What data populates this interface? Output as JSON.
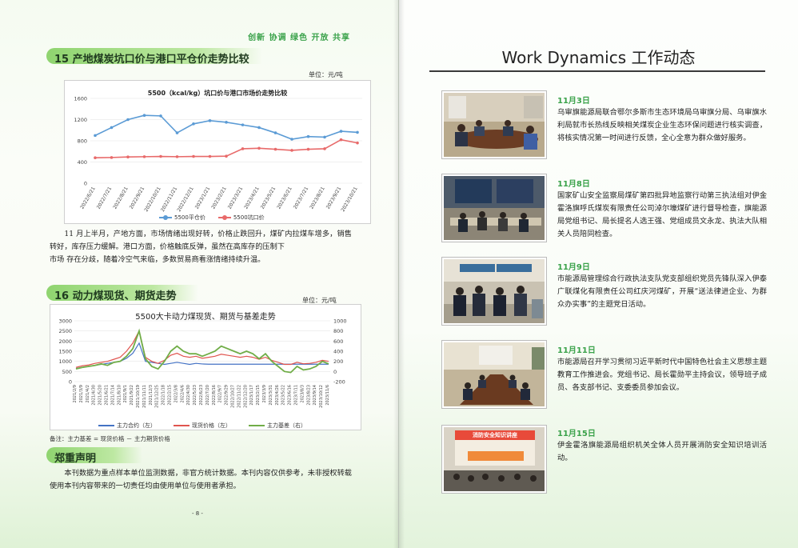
{
  "left": {
    "slogan": "创新 协调 绿色 开放 共享",
    "section15": {
      "heading": "15 产地煤炭坑口价与港口平仓价走势比较",
      "unit": "单位：元/吨",
      "paragraph_a": "11 月上半月，产地方面，市场情绪出现好转，价格止跌回升，煤矿内拉煤车增多，销售转好，库存压力缓解。港口方面，价格触底反弹，虽然在高库存的压制下",
      "paragraph_b": "市场 存在分歧，随着冷空气来临，多数贸易商看涨情绪持续升温。"
    },
    "section16": {
      "heading": "16 动力煤现货、期货走势图",
      "unit": "单位：元/吨",
      "note": "备注：主力基差 = 现货价格 － 主力期货价格"
    },
    "disclaimer": {
      "heading": "郑重声明",
      "text": "本刊数据为重点样本单位监测数据，非官方统计数据。本刊内容仅供参考，未非授权转载使用本刊内容带来的一切责任均由使用单位与使用者承担。"
    },
    "page_number": "- 8 -"
  },
  "chart_data": [
    {
      "type": "line",
      "title": "5500（kcal/kg）坑口价与港口市场价走势比较",
      "ylim": [
        0,
        1600
      ],
      "yticks": [
        "0",
        "400",
        "800",
        "1200",
        "1600"
      ],
      "categories": [
        "2022/6/21",
        "2022/7/21",
        "2022/8/21",
        "2022/9/21",
        "2022/10/21",
        "2022/11/21",
        "2022/12/21",
        "2023/1/21",
        "2023/2/21",
        "2023/3/21",
        "2023/4/21",
        "2023/5/21",
        "2023/6/21",
        "2023/7/21",
        "2023/8/21",
        "2023/9/21",
        "2023/10/21"
      ],
      "series": [
        {
          "name": "5500平仓价",
          "color": "#5b9bd5",
          "values": [
            900,
            1050,
            1200,
            1280,
            1270,
            950,
            1120,
            1180,
            1150,
            1100,
            1050,
            950,
            830,
            880,
            870,
            980,
            960
          ]
        },
        {
          "name": "5500坑口价",
          "color": "#e86a6a",
          "values": [
            480,
            485,
            495,
            500,
            505,
            500,
            505,
            505,
            510,
            650,
            660,
            640,
            620,
            640,
            650,
            820,
            760
          ]
        }
      ]
    },
    {
      "type": "line",
      "title": "5500大卡动力煤现货、期货与基差走势",
      "ylim": [
        0,
        3000
      ],
      "y2lim": [
        -200,
        1000
      ],
      "yticks": [
        "0",
        "500",
        "1000",
        "1500",
        "2000",
        "2500",
        "3000"
      ],
      "y2ticks": [
        "-200",
        "0",
        "200",
        "400",
        "600",
        "800",
        "1000"
      ],
      "categories": [
        "2021/2/9",
        "2021/3/9",
        "2021/4/2",
        "2021/4/30",
        "2021/5/20",
        "2021/6/21",
        "2021/7/14",
        "2021/8/10",
        "2021/9/1",
        "2021/9/22",
        "2021/10/19",
        "2021/11/11",
        "2021/12/3",
        "2021/12/25",
        "2022/1/18",
        "2022/2/15",
        "2022/3/8",
        "2022/4/6",
        "2022/4/30",
        "2022/5/23",
        "2022/6/23",
        "2022/7/20",
        "2022/8/16",
        "2022/9/7",
        "2022/9/29",
        "2022/10/27",
        "2022/11/22",
        "2022/12/20",
        "2023/1/17",
        "2023/2/15",
        "2023/3/9",
        "2023/3/31",
        "2023/4/26",
        "2023/5/22",
        "2023/6/16",
        "2023/7/11",
        "2023/8/3",
        "2023/8/23",
        "2023/9/14",
        "2023/10/12",
        "2023/11/6"
      ],
      "series": [
        {
          "name": "主力合约（左）",
          "color": "#4472c4",
          "values": [
            650,
            700,
            750,
            800,
            850,
            900,
            950,
            1000,
            1150,
            1400,
            1900,
            1000,
            950,
            900,
            850,
            900,
            950,
            900,
            850,
            900,
            870,
            860,
            860,
            860,
            860,
            860,
            860,
            860,
            860,
            860,
            860,
            860,
            860,
            860,
            860,
            860,
            860,
            860,
            860,
            860,
            860
          ]
        },
        {
          "name": "现货价格（左）",
          "color": "#e0544f",
          "values": [
            700,
            780,
            820,
            900,
            950,
            1000,
            1100,
            1200,
            1500,
            1900,
            2500,
            1200,
            1000,
            900,
            1050,
            1300,
            1400,
            1250,
            1200,
            1250,
            1150,
            1200,
            1250,
            1350,
            1300,
            1250,
            1200,
            1250,
            1200,
            1100,
            1200,
            1050,
            950,
            850,
            850,
            950,
            880,
            900,
            950,
            1050,
            1000
          ]
        },
        {
          "name": "主力基差（右）",
          "color": "#70ad47",
          "values": [
            50,
            80,
            100,
            120,
            150,
            120,
            180,
            200,
            300,
            450,
            800,
            250,
            100,
            50,
            200,
            400,
            500,
            400,
            350,
            350,
            300,
            350,
            400,
            500,
            450,
            400,
            350,
            400,
            350,
            250,
            350,
            200,
            100,
            0,
            -20,
            100,
            30,
            50,
            100,
            200,
            150
          ]
        }
      ]
    }
  ],
  "right": {
    "title": "Work Dynamics  工作动态",
    "items": [
      {
        "date": "11月3日",
        "text": "乌审旗能源局联合鄂尔多斯市生态环境局乌审旗分局、乌审旗水利局就市长热线反映相关煤炭企业生态环保问题进行核实调查，将核实情况第一时间进行反馈，全心全意为群众做好服务。"
      },
      {
        "date": "11月8日",
        "text": "国家矿山安全监察局煤矿第四批异地监察行动第三执法组对伊金霍洛旗呼氏煤炭有限责任公司淖尔壕煤矿进行督导检查，旗能源局党组书记、局长提名人选王强、党组成员文永龙、执法大队相关人员陪同检查。"
      },
      {
        "date": "11月9日",
        "text": "市能源局管理综合行政执法支队党支部组织党员先锋队深入伊泰广联煤化有限责任公司红庆河煤矿，开展“送法律进企业、为群众办实事”的主题党日活动。"
      },
      {
        "date": "11月11日",
        "text": "市能源局召开学习贯彻习近平新时代中国特色社会主义思想主题教育工作推进会。党组书记、局长霍勋平主持会议，领导班子成员、各支部书记、支委委员参加会议。"
      },
      {
        "date": "11月15日",
        "text": "伊金霍洛旗能源局组织机关全体人员开展消防安全知识培训活动。"
      }
    ],
    "photo5_banner": "消防安全知识讲座"
  }
}
